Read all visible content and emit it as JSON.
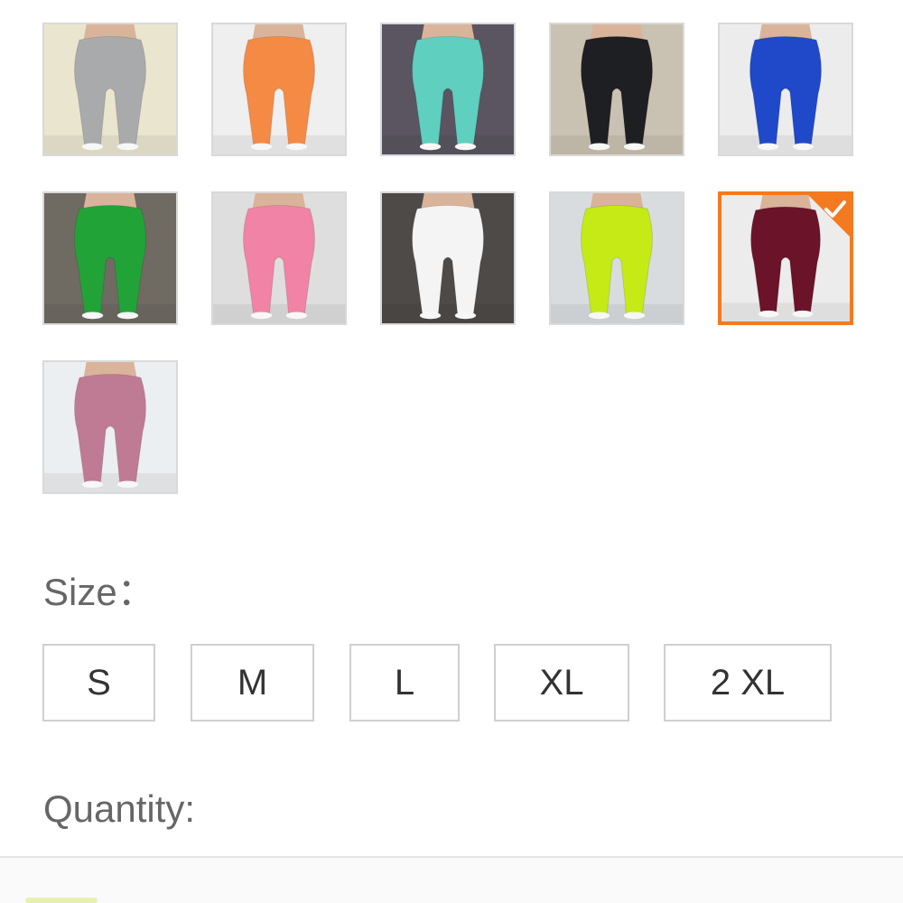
{
  "color_swatches": [
    {
      "name": "gray",
      "color": "#a9aaab",
      "bg": "#e9e5cf",
      "selected": false
    },
    {
      "name": "orange",
      "color": "#f58a45",
      "bg": "#efefef",
      "selected": false
    },
    {
      "name": "mint",
      "color": "#5fcfbf",
      "bg": "#5a5560",
      "selected": false
    },
    {
      "name": "black",
      "color": "#1e1f23",
      "bg": "#c9c2b2",
      "selected": false
    },
    {
      "name": "blue",
      "color": "#1f49c8",
      "bg": "#ececec",
      "selected": false
    },
    {
      "name": "green",
      "color": "#22a338",
      "bg": "#6f6a62",
      "selected": false
    },
    {
      "name": "pink",
      "color": "#f083a6",
      "bg": "#dedede",
      "selected": false
    },
    {
      "name": "white",
      "color": "#f4f4f4",
      "bg": "#4d4a48",
      "selected": false
    },
    {
      "name": "lime",
      "color": "#c5ea15",
      "bg": "#d8dcdf",
      "selected": false
    },
    {
      "name": "wine",
      "color": "#6b1329",
      "bg": "#ececec",
      "selected": true
    },
    {
      "name": "mauve",
      "color": "#c07b94",
      "bg": "#eceff1",
      "selected": false
    }
  ],
  "size_section": {
    "label": "Size：",
    "options": [
      "S",
      "M",
      "L",
      "XL",
      "2 XL"
    ]
  },
  "quantity_section": {
    "label": "Quantity:"
  },
  "colors": {
    "accent": "#f47a20",
    "border": "#cfcfcf",
    "label_text": "#666666",
    "option_text": "#333333"
  },
  "icons": {
    "selected_badge": "check-icon"
  }
}
